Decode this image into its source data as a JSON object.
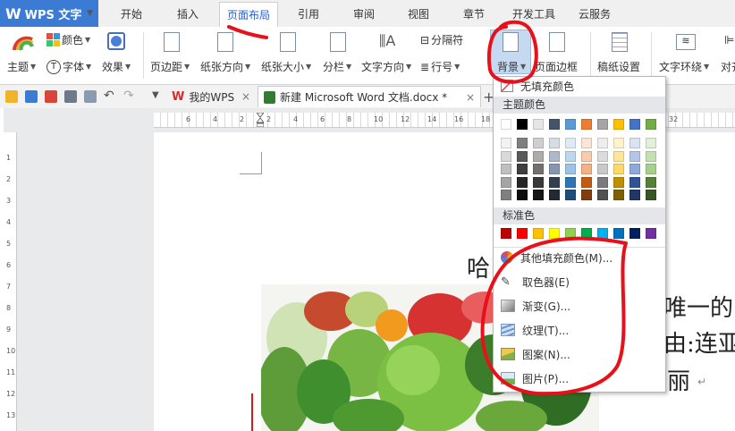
{
  "app": {
    "name": "WPS 文字"
  },
  "tabs": [
    "开始",
    "插入",
    "页面布局",
    "引用",
    "审阅",
    "视图",
    "章节",
    "开发工具",
    "云服务"
  ],
  "ribbon": {
    "theme": "主题",
    "colors": "颜色",
    "fonts": "字体",
    "effects": "效果",
    "margins": "页边距",
    "orientation": "纸张方向",
    "size": "纸张大小",
    "columns": "分栏",
    "text_direction": "文字方向",
    "separator": "分隔符",
    "line_numbers": "行号",
    "background": "背景",
    "page_border": "页面边框",
    "manuscript": "稿纸设置",
    "wrap": "文字环绕",
    "align": "对齐"
  },
  "doc_tabs": [
    {
      "label": "我的WPS"
    },
    {
      "label": "新建 Microsoft Word 文档.docx *"
    }
  ],
  "document": {
    "title_char": "哈",
    "line1": "唯一的",
    "line2": "由:连亚",
    "line3": "丽"
  },
  "ruler": {
    "top_labels": [
      "6",
      "4",
      "2",
      "2",
      "4",
      "6",
      "8",
      "10",
      "12",
      "14",
      "16",
      "18",
      "20",
      "22",
      "24",
      "26",
      "28",
      "30",
      "32"
    ],
    "left_labels": [
      "1",
      "2",
      "3",
      "4",
      "5",
      "6",
      "7",
      "8",
      "9",
      "10",
      "11",
      "12",
      "13"
    ]
  },
  "menu": {
    "no_fill": "无填充颜色",
    "theme_colors_title": "主题颜色",
    "standard_colors_title": "标准色",
    "more_colors": "其他填充颜色(M)...",
    "eyedropper": "取色器(E)",
    "gradient": "渐变(G)...",
    "texture": "纹理(T)...",
    "pattern": "图案(N)...",
    "picture": "图片(P)..."
  },
  "colors": {
    "theme_top": [
      "#ffffff",
      "#000000",
      "#e7e6e6",
      "#44546a",
      "#5b9bd5",
      "#ed7d31",
      "#a5a5a5",
      "#ffc000",
      "#4472c4",
      "#70ad47"
    ],
    "theme_shades": [
      [
        "#f2f2f2",
        "#7f7f7f",
        "#d0cece",
        "#d6dce4",
        "#deebf6",
        "#fbe5d5",
        "#ededed",
        "#fff2cc",
        "#dae3f3",
        "#e2efd9"
      ],
      [
        "#d9d9d9",
        "#595959",
        "#aeabab",
        "#adb9ca",
        "#bdd7ee",
        "#f7cbac",
        "#dbdbdb",
        "#fee599",
        "#b4c6e7",
        "#c5e0b3"
      ],
      [
        "#bfbfbf",
        "#3f3f3f",
        "#757070",
        "#8496b0",
        "#9dc3e6",
        "#f4b183",
        "#c9c9c9",
        "#ffd965",
        "#8eaadb",
        "#a8d08d"
      ],
      [
        "#a5a5a5",
        "#262626",
        "#3a3838",
        "#323f4f",
        "#2e75b5",
        "#c55a11",
        "#7b7b7b",
        "#bf9000",
        "#2f5496",
        "#538135"
      ],
      [
        "#7f7f7f",
        "#0c0c0c",
        "#171616",
        "#222a35",
        "#1e4e79",
        "#833c0b",
        "#525252",
        "#7f6000",
        "#1f3864",
        "#375623"
      ]
    ],
    "standard": [
      "#c00000",
      "#ff0000",
      "#ffc000",
      "#ffff00",
      "#92d050",
      "#00b050",
      "#00b0f0",
      "#0070c0",
      "#002060",
      "#7030a0"
    ],
    "annotation": "#e8101a",
    "accent": "#3b7bd4"
  }
}
